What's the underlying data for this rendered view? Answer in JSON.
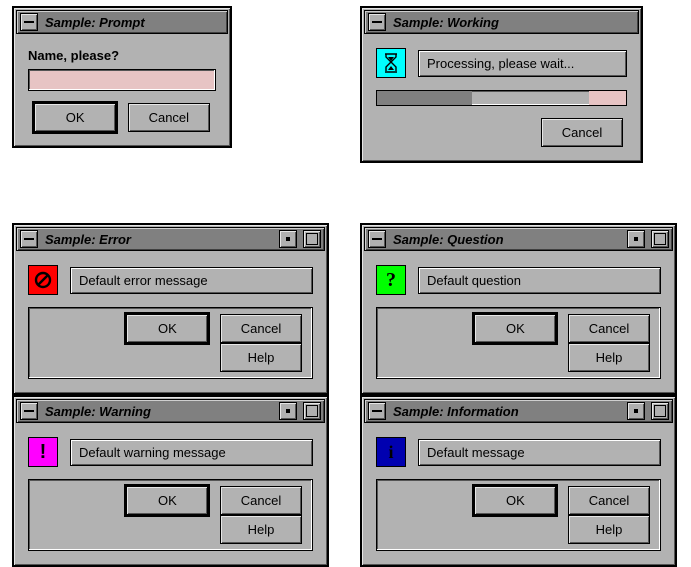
{
  "prompt": {
    "title": "Sample: Prompt",
    "label": "Name, please?",
    "value": "",
    "ok": "OK",
    "cancel": "Cancel"
  },
  "working": {
    "title": "Sample: Working",
    "message": "Processing, please wait...",
    "cancel": "Cancel",
    "progress_pct": 38,
    "tail_pct": 15,
    "icon_color": "#00ffff"
  },
  "error": {
    "title": "Sample: Error",
    "message": "Default error message",
    "ok": "OK",
    "cancel": "Cancel",
    "help": "Help",
    "icon_color": "#ff0000"
  },
  "question": {
    "title": "Sample: Question",
    "message": "Default question",
    "ok": "OK",
    "cancel": "Cancel",
    "help": "Help",
    "icon_glyph": "?",
    "icon_color": "#00ff00"
  },
  "warning": {
    "title": "Sample: Warning",
    "message": "Default warning message",
    "ok": "OK",
    "cancel": "Cancel",
    "help": "Help",
    "icon_glyph": "!",
    "icon_color": "#ff00ff"
  },
  "information": {
    "title": "Sample: Information",
    "message": "Default message",
    "ok": "OK",
    "cancel": "Cancel",
    "help": "Help",
    "icon_glyph": "i",
    "icon_color": "#0000b0"
  }
}
